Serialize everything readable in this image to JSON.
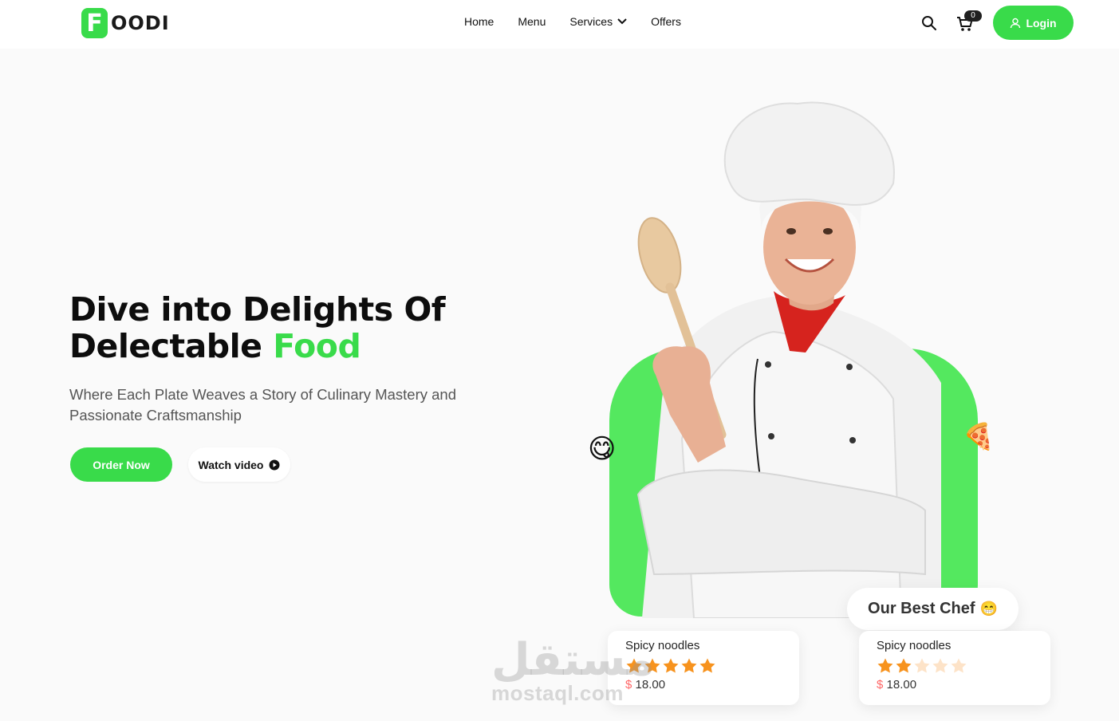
{
  "header": {
    "logo_letter": "F",
    "logo_text": "OODI",
    "nav": [
      {
        "label": "Home"
      },
      {
        "label": "Menu"
      },
      {
        "label": "Services"
      },
      {
        "label": "Offers"
      }
    ],
    "cart_count": "0",
    "login_label": "Login"
  },
  "hero": {
    "title_line1": "Dive into Delights Of",
    "title_line2_plain": "Delectable ",
    "title_line2_accent": "Food",
    "subtitle": "Where Each Plate Weaves a Story of Culinary Mastery and Passionate Craftsmanship",
    "order_button": "Order Now",
    "watch_button": "Watch video"
  },
  "chef": {
    "badge_text": "Our Best Chef",
    "badge_emoji": "😁",
    "emoji_left": "😋",
    "emoji_right": "🍕"
  },
  "cards": [
    {
      "title": "Spicy noodles",
      "rating": 5,
      "max_rating": 5,
      "currency": "$",
      "price": "18.00"
    },
    {
      "title": "Spicy noodles",
      "rating": 2,
      "max_rating": 5,
      "currency": "$",
      "price": "18.00"
    }
  ],
  "watermark": {
    "arabic": "مستقل",
    "latin": "mostaql.com"
  },
  "colors": {
    "accent": "#39db4a",
    "arch": "#54e85f",
    "star": "#f7931e",
    "star_empty": "#fde3c8",
    "price_currency": "#ff6868"
  },
  "icons": [
    "search-icon",
    "cart-icon",
    "user-icon",
    "chevron-down-icon",
    "play-icon",
    "star-icon"
  ]
}
